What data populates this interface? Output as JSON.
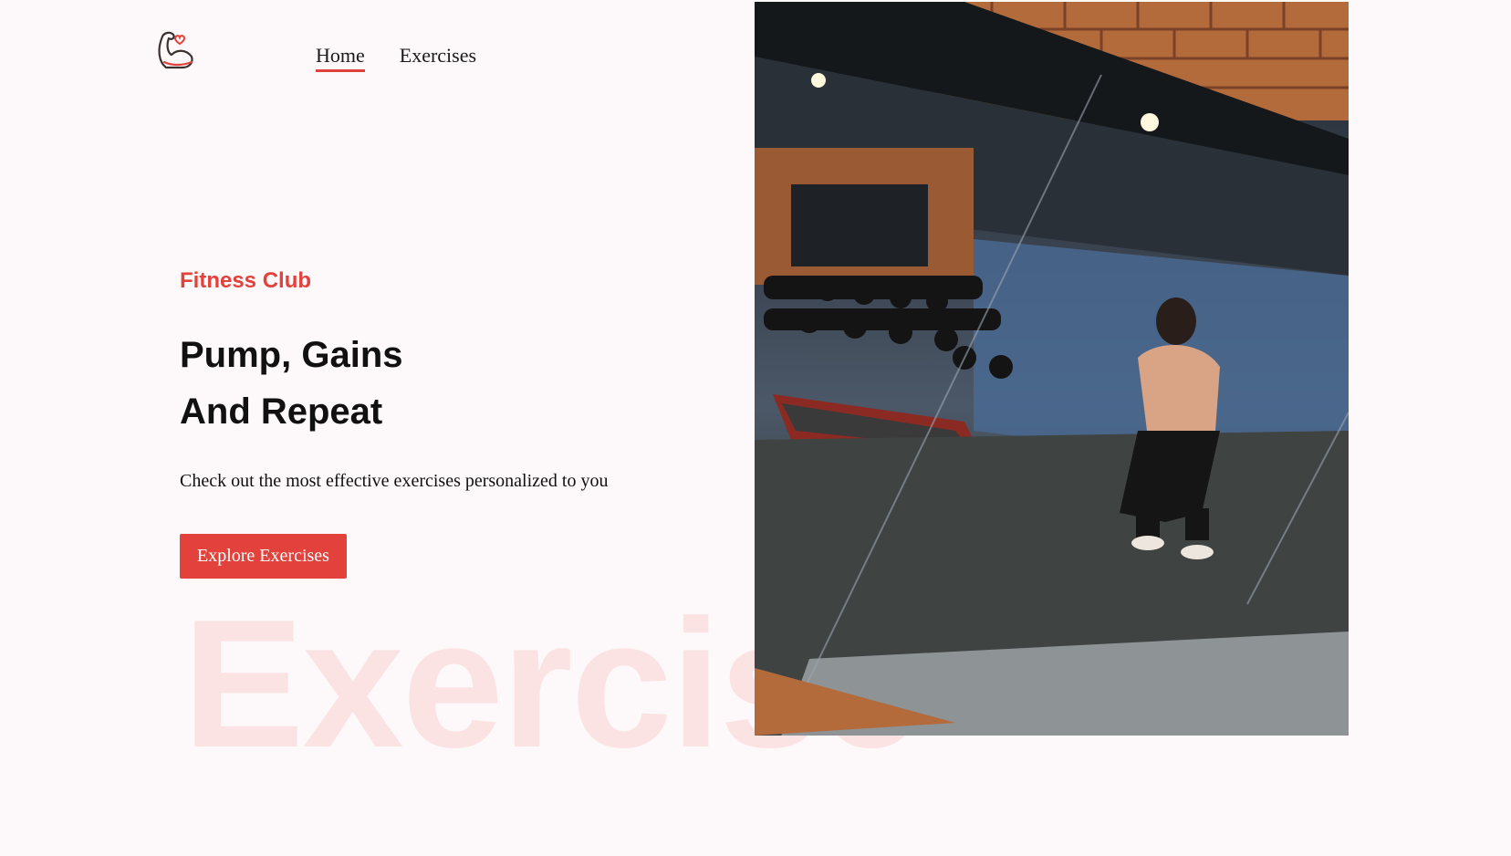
{
  "brand": {
    "logo_icon": "flexed-arm-heart-icon",
    "accent": "#e2423b"
  },
  "nav": {
    "items": [
      {
        "label": "Home",
        "active": true
      },
      {
        "label": "Exercises",
        "active": false
      }
    ]
  },
  "hero": {
    "eyebrow": "Fitness Club",
    "headline_line1": "Pump, Gains",
    "headline_line2": "And Repeat",
    "subtitle": "Check out the most effective exercises personalized to you",
    "cta_label": "Explore Exercises",
    "watermark": "Exercise"
  },
  "banner": {
    "alt": "gym mirror selfie"
  }
}
